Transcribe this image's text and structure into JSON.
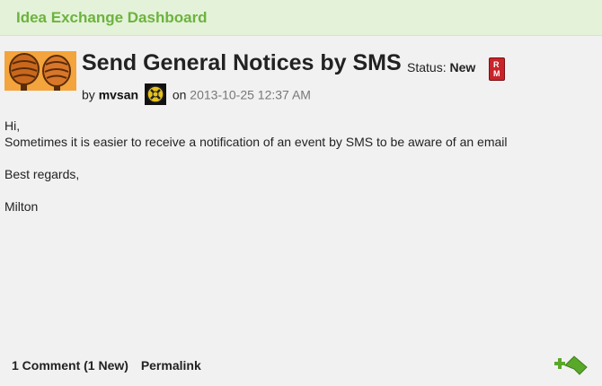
{
  "header": {
    "title": "Idea Exchange Dashboard"
  },
  "idea": {
    "title": "Send General Notices by SMS",
    "status_label": "Status:",
    "status_value": "New",
    "status_badge_text": [
      "R",
      "M"
    ],
    "by_label": "by",
    "author": "mvsan",
    "on_label": "on",
    "date": "2013-10-25 12:37 AM"
  },
  "body": {
    "lines": [
      "Hi,",
      "Sometimes it is easier to receive a notification of an event by SMS  to be aware of an email",
      "",
      "Best regards,",
      "",
      "Milton"
    ]
  },
  "footer": {
    "comments": "1 Comment (1 New)",
    "permalink": "Permalink"
  },
  "icons": {
    "avatar": "maracas-avatar",
    "rank": "rank-icon",
    "kudo": "kudo-plus-icon"
  },
  "colors": {
    "header_bg": "#e4f2d9",
    "header_text": "#6cb33e",
    "status_badge": "#c8242a",
    "kudo_green": "#5aa82a"
  }
}
